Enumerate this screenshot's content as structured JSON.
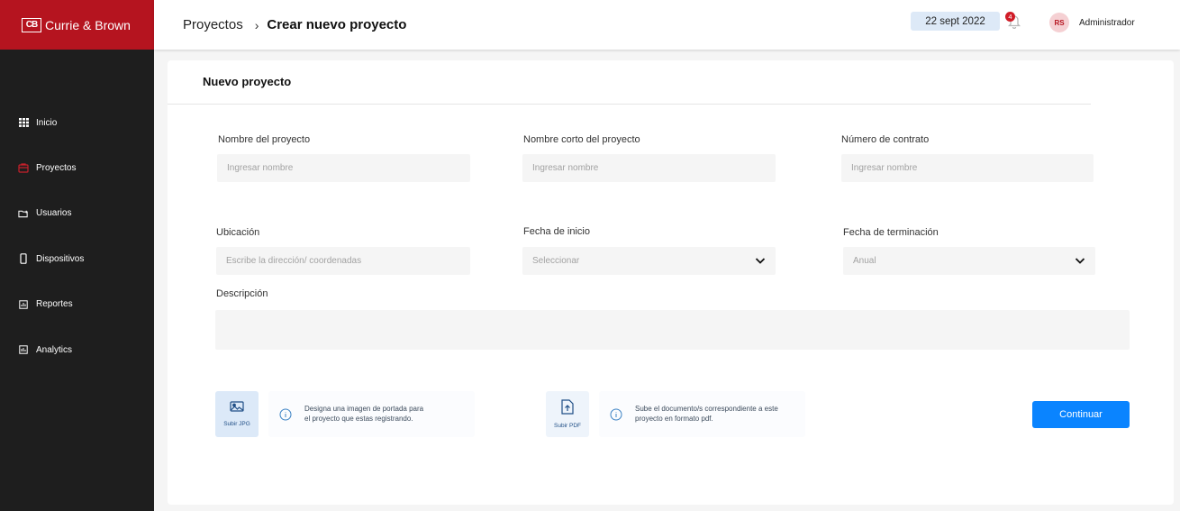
{
  "brand": {
    "mark": "CB",
    "name": "Currie & Brown"
  },
  "sidebar": {
    "items": [
      {
        "label": "Inicio",
        "icon": "grid-icon"
      },
      {
        "label": "Proyectos",
        "icon": "projects-icon",
        "active": true
      },
      {
        "label": "Usuarios",
        "icon": "users-folder-icon"
      },
      {
        "label": "Dispositivos",
        "icon": "device-icon"
      },
      {
        "label": "Reportes",
        "icon": "report-icon"
      },
      {
        "label": "Analytics",
        "icon": "analytics-icon"
      }
    ]
  },
  "header": {
    "breadcrumb_parent": "Proyectos",
    "breadcrumb_separator": "›",
    "breadcrumb_current": "Crear nuevo proyecto",
    "date": "22 sept 2022",
    "notifications_count": "4",
    "avatar_initials": "RS",
    "user_name": "Administrador"
  },
  "form": {
    "title": "Nuevo proyecto",
    "project_name": {
      "label": "Nombre del proyecto",
      "placeholder": "Ingresar nombre"
    },
    "short_name": {
      "label": "Nombre corto del proyecto",
      "placeholder": "Ingresar nombre"
    },
    "contract_number": {
      "label": "Número de contrato",
      "placeholder": "Ingresar nombre"
    },
    "location": {
      "label": "Ubicación",
      "placeholder": "Escribe la dirección/ coordenadas"
    },
    "start_date": {
      "label": "Fecha de inicio",
      "value": "Seleccionar"
    },
    "end_date": {
      "label": "Fecha de terminación",
      "value": "Anual"
    },
    "description": {
      "label": "Descripción"
    }
  },
  "uploads": {
    "image": {
      "label": "Subir JPG",
      "info_line1": "Designa una imagen de portada para",
      "info_line2": "el proyecto que estas registrando."
    },
    "pdf": {
      "label": "Subir PDF",
      "info_line1": "Sube el documento/s correspondiente a este",
      "info_line2": "proyecto en formato pdf."
    }
  },
  "actions": {
    "continue_label": "Continuar"
  },
  "colors": {
    "brand_red": "#b5141f",
    "sidebar_bg": "#1e1e1e",
    "primary_blue": "#0a84ff",
    "date_pill": "#dde9f7"
  }
}
